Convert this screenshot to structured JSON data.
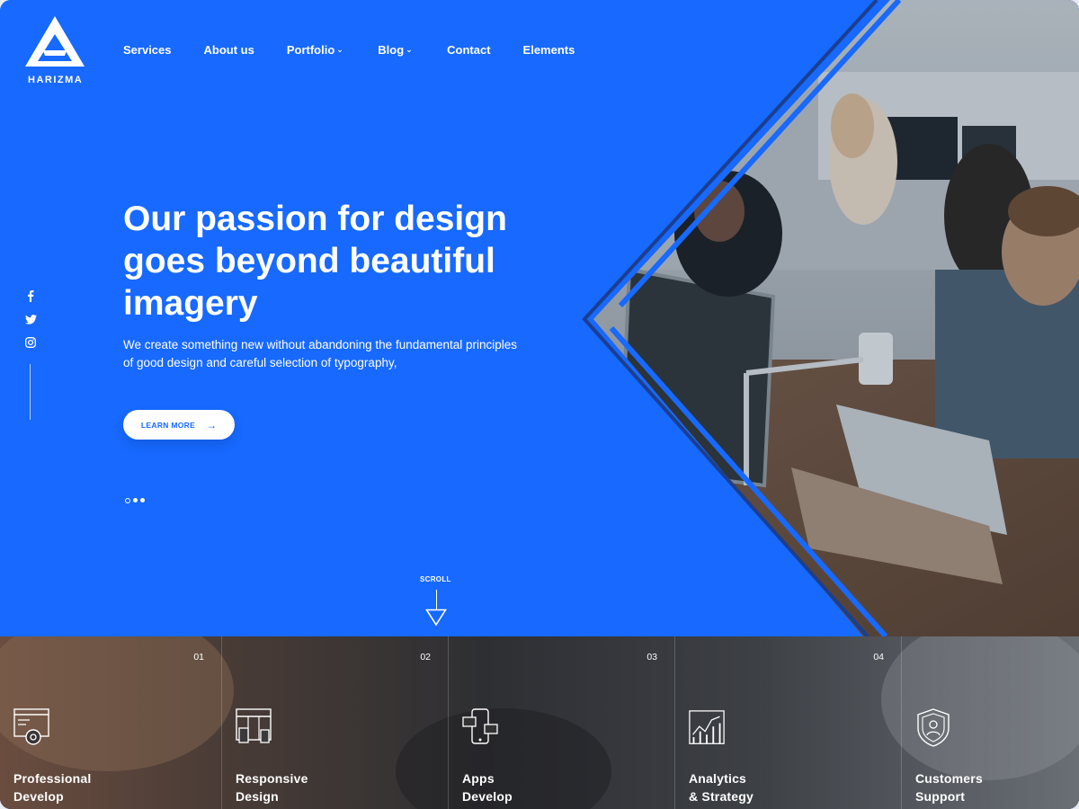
{
  "brand": {
    "name": "HARIZMA",
    "accent": "#1769ff"
  },
  "nav": {
    "items": [
      {
        "label": "Services",
        "dropdown": false
      },
      {
        "label": "About us",
        "dropdown": false
      },
      {
        "label": "Portfolio",
        "dropdown": true
      },
      {
        "label": "Blog",
        "dropdown": true
      },
      {
        "label": "Contact",
        "dropdown": false
      },
      {
        "label": "Elements",
        "dropdown": false
      }
    ]
  },
  "hero": {
    "headline_line1": "Our passion for design",
    "headline_line2": "goes beyond beautiful",
    "headline_line3": "imagery",
    "sub_line1": "We create something new without abandoning the fundamental principles",
    "sub_line2": "of good design and careful selection of typography,",
    "button_label": "LEARN MORE",
    "scroll_label": "SCROLL"
  },
  "social": [
    "facebook-icon",
    "twitter-icon",
    "instagram-icon"
  ],
  "services": [
    {
      "number": "01",
      "line1": "Professional",
      "line2": "Develop",
      "icon": "code-gear-icon"
    },
    {
      "number": "02",
      "line1": "Responsive",
      "line2": "Design",
      "icon": "responsive-devices-icon"
    },
    {
      "number": "03",
      "line1": "Apps",
      "line2": "Develop",
      "icon": "mobile-app-icon"
    },
    {
      "number": "04",
      "line1": "Analytics",
      "line2": "& Strategy",
      "icon": "analytics-chart-icon"
    },
    {
      "number": "",
      "line1": "Customers",
      "line2": "Support",
      "icon": "user-shield-icon"
    }
  ]
}
